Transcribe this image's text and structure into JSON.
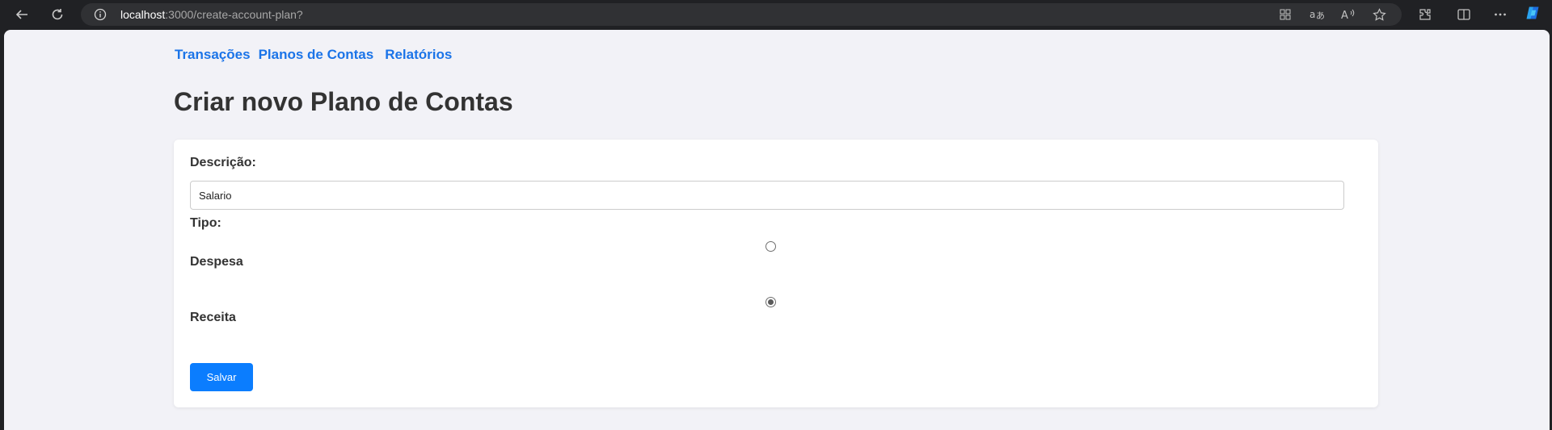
{
  "browser": {
    "url_host": "localhost",
    "url_rest": ":3000/create-account-plan?"
  },
  "nav": {
    "items": [
      "Transações",
      "Planos de Contas",
      "Relatórios"
    ]
  },
  "page": {
    "title": "Criar novo Plano de Contas"
  },
  "form": {
    "description_label": "Descrição:",
    "description_value": "Salario",
    "type_label": "Tipo:",
    "options": [
      {
        "label": "Despesa",
        "checked": false
      },
      {
        "label": "Receita",
        "checked": true
      }
    ],
    "save_label": "Salvar"
  },
  "colors": {
    "accent": "#0b7dfe",
    "link": "#1b74e8",
    "background": "#f2f2f7"
  }
}
